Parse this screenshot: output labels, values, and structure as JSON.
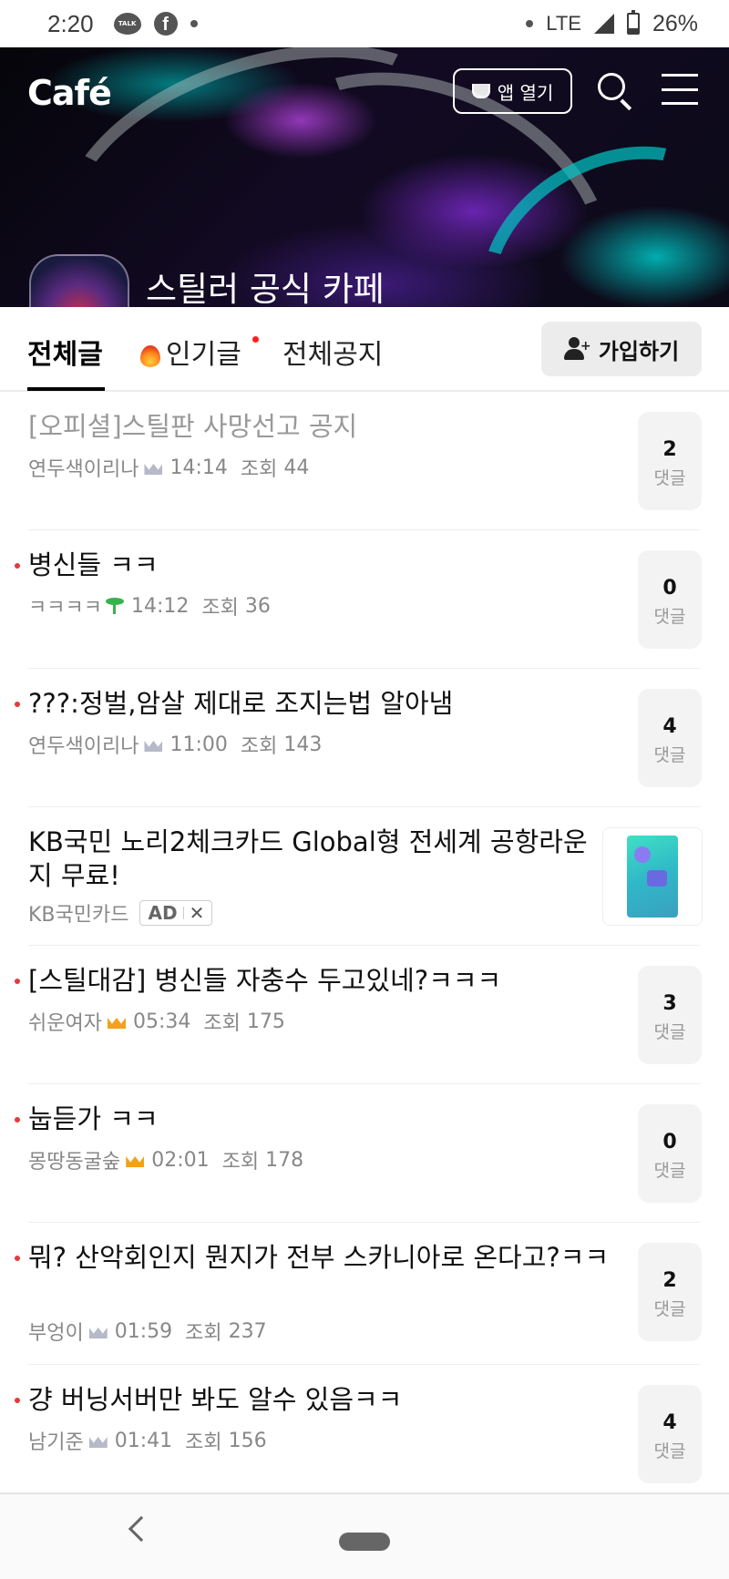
{
  "status_bar": {
    "time": "2:20",
    "talk_icon_text": "TALK",
    "network": "LTE",
    "battery": "26%"
  },
  "header": {
    "logo": "Café",
    "open_app_label": "앱 열기",
    "cafe_name": "스틸러 공식 카페"
  },
  "tabs": [
    {
      "label": "전체글",
      "active": true
    },
    {
      "label": "인기글",
      "active": false,
      "icon": "fire-icon",
      "new_dot": true
    },
    {
      "label": "전체공지",
      "active": false
    }
  ],
  "join_button": "가입하기",
  "comment_label": "댓글",
  "views_label": "조회",
  "posts": [
    {
      "title": "[오피셜]스틸판 사망선고 공지",
      "read": true,
      "author": "연두색이리나",
      "badge": "crown-gray",
      "time": "14:14",
      "views": "44",
      "comments": "2"
    },
    {
      "title": "병신들 ㅋㅋ",
      "read": false,
      "author": "ㅋㅋㅋㅋ",
      "badge": "sprout",
      "time": "14:12",
      "views": "36",
      "comments": "0"
    },
    {
      "title": "???:정벌,암살 제대로 조지는법 알아냄",
      "read": false,
      "author": "연두색이리나",
      "badge": "crown-gray",
      "time": "11:00",
      "views": "143",
      "comments": "4"
    },
    {
      "title": "[스틸대감] 병신들 자충수 두고있네?ㅋㅋㅋ",
      "read": false,
      "author": "쉬운여자",
      "badge": "crown-gold",
      "time": "05:34",
      "views": "175",
      "comments": "3"
    },
    {
      "title": "눕듣가 ㅋㅋ",
      "read": false,
      "author": "몽땅동굴숲",
      "badge": "crown-gold",
      "time": "02:01",
      "views": "178",
      "comments": "0"
    },
    {
      "title": "뭐? 산악회인지 뭔지가 전부 스카니아로 온다고?ㅋㅋ",
      "read": false,
      "author": "부엉이",
      "badge": "crown-gray",
      "time": "01:59",
      "views": "237",
      "comments": "2"
    },
    {
      "title": "걍 버닝서버만 봐도 알수 있음ㅋㅋ",
      "read": false,
      "author": "남기준",
      "badge": "crown-gray",
      "time": "01:41",
      "views": "156",
      "comments": "4"
    }
  ],
  "ad": {
    "title": "KB국민 노리2체크카드 Global형 전세계 공항라운지 무료!",
    "advertiser": "KB국민카드",
    "badge": "AD",
    "close": "✕"
  },
  "colors": {
    "new_dot": "#e8383a",
    "comment_box_bg": "#f3f3f3",
    "crown_gray": "#b6b9c8",
    "crown_gold": "#f3a11b",
    "sprout": "#37b24d"
  }
}
